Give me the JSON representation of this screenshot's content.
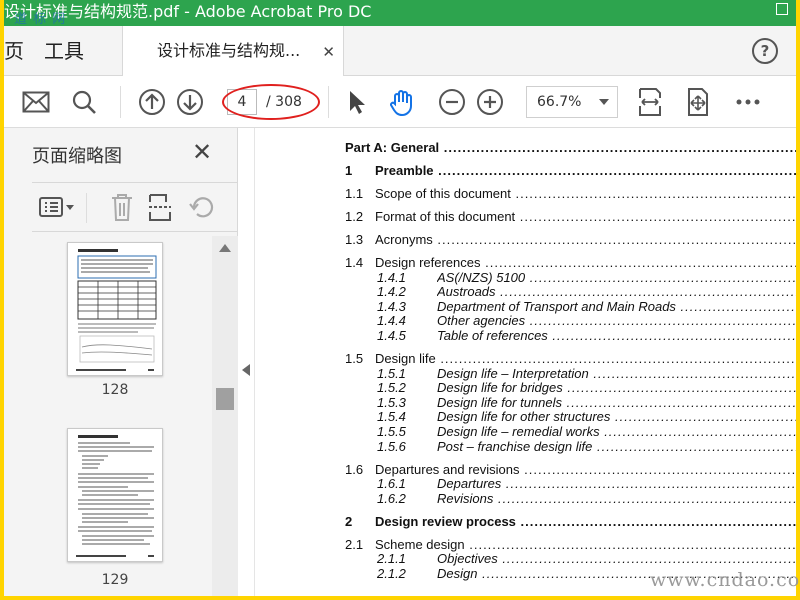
{
  "window": {
    "title": "设计标准与结构规范.pdf - Adobe Acrobat Pro DC",
    "watermark_top": "道 标 网",
    "watermark_bottom": "www.cndao.com"
  },
  "tabs": {
    "home": "页",
    "tools": "工具",
    "document": "设计标准与结构规...",
    "help": "?"
  },
  "toolbar": {
    "page_current": "4",
    "page_total": "/ 308",
    "zoom": "66.7%"
  },
  "sidebar": {
    "title": "页面缩略图",
    "thumbnails": [
      {
        "label": "128"
      },
      {
        "label": "129"
      }
    ]
  },
  "toc": [
    {
      "num": "",
      "text": "Part A: General",
      "level": "part"
    },
    {
      "num": "1",
      "text": "Preamble",
      "level": "bold"
    },
    {
      "num": "1.1",
      "text": "Scope of this document",
      "level": "section"
    },
    {
      "num": "1.2",
      "text": "Format of this document",
      "level": "section"
    },
    {
      "num": "1.3",
      "text": "Acronyms",
      "level": "section"
    },
    {
      "num": "1.4",
      "text": "Design references",
      "level": "section"
    },
    {
      "num": "1.4.1",
      "text": "AS(/NZS) 5100",
      "level": "sub"
    },
    {
      "num": "1.4.2",
      "text": "Austroads",
      "level": "sub"
    },
    {
      "num": "1.4.3",
      "text": "Department of Transport and Main Roads",
      "level": "sub"
    },
    {
      "num": "1.4.4",
      "text": "Other agencies",
      "level": "sub"
    },
    {
      "num": "1.4.5",
      "text": "Table of references",
      "level": "sub"
    },
    {
      "num": "1.5",
      "text": "Design life",
      "level": "section"
    },
    {
      "num": "1.5.1",
      "text": "Design life – Interpretation",
      "level": "sub"
    },
    {
      "num": "1.5.2",
      "text": "Design life for bridges",
      "level": "sub"
    },
    {
      "num": "1.5.3",
      "text": "Design life for tunnels",
      "level": "sub"
    },
    {
      "num": "1.5.4",
      "text": "Design life for other structures",
      "level": "sub"
    },
    {
      "num": "1.5.5",
      "text": "Design life – remedial works",
      "level": "sub"
    },
    {
      "num": "1.5.6",
      "text": "Post – franchise design life",
      "level": "sub"
    },
    {
      "num": "1.6",
      "text": "Departures and revisions",
      "level": "section"
    },
    {
      "num": "1.6.1",
      "text": "Departures",
      "level": "sub"
    },
    {
      "num": "1.6.2",
      "text": "Revisions",
      "level": "sub"
    },
    {
      "num": "2",
      "text": "Design review process",
      "level": "bold"
    },
    {
      "num": "2.1",
      "text": "Scheme design",
      "level": "section"
    },
    {
      "num": "2.1.1",
      "text": "Objectives",
      "level": "sub"
    },
    {
      "num": "2.1.2",
      "text": "Design",
      "level": "sub"
    }
  ]
}
